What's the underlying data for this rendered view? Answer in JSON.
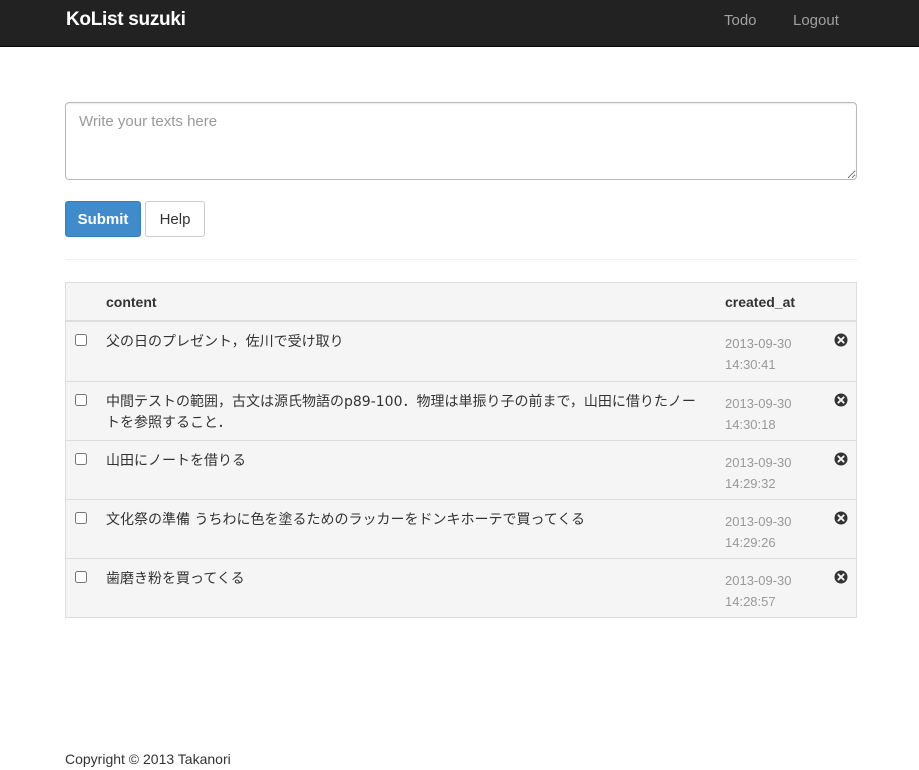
{
  "navbar": {
    "brand": "KoList suzuki",
    "links": [
      "Todo",
      "Logout"
    ]
  },
  "compose": {
    "placeholder": "Write your texts here",
    "value": ""
  },
  "buttons": {
    "submit_label": "Submit",
    "help_label": "Help"
  },
  "table": {
    "headers": {
      "content": "content",
      "created_at": "created_at"
    },
    "rows": [
      {
        "content": "父の日のプレゼント，佐川で受け取り",
        "date": "2013-09-30",
        "time": "14:30:41",
        "checked": false
      },
      {
        "content": "中間テストの範囲，古文は源氏物語のp89-100．物理は単振り子の前まで，山田に借りたノートを参照すること．",
        "date": "2013-09-30",
        "time": "14:30:18",
        "checked": false
      },
      {
        "content": "山田にノートを借りる",
        "date": "2013-09-30",
        "time": "14:29:32",
        "checked": false
      },
      {
        "content": "文化祭の準備 うちわに色を塗るためのラッカーをドンキホーテで買ってくる",
        "date": "2013-09-30",
        "time": "14:29:26",
        "checked": false
      },
      {
        "content": "歯磨き粉を買ってくる",
        "date": "2013-09-30",
        "time": "14:28:57",
        "checked": false
      }
    ],
    "row_action_icon": "remove-circle-icon"
  },
  "footer": {
    "copyright": "Copyright © 2013 Takanori"
  },
  "colors": {
    "navbar_bg": "#222222",
    "nav_link": "#a0a0a0",
    "primary": "#428bca",
    "table_bg": "#f5f5f5",
    "muted_text": "#999999"
  }
}
